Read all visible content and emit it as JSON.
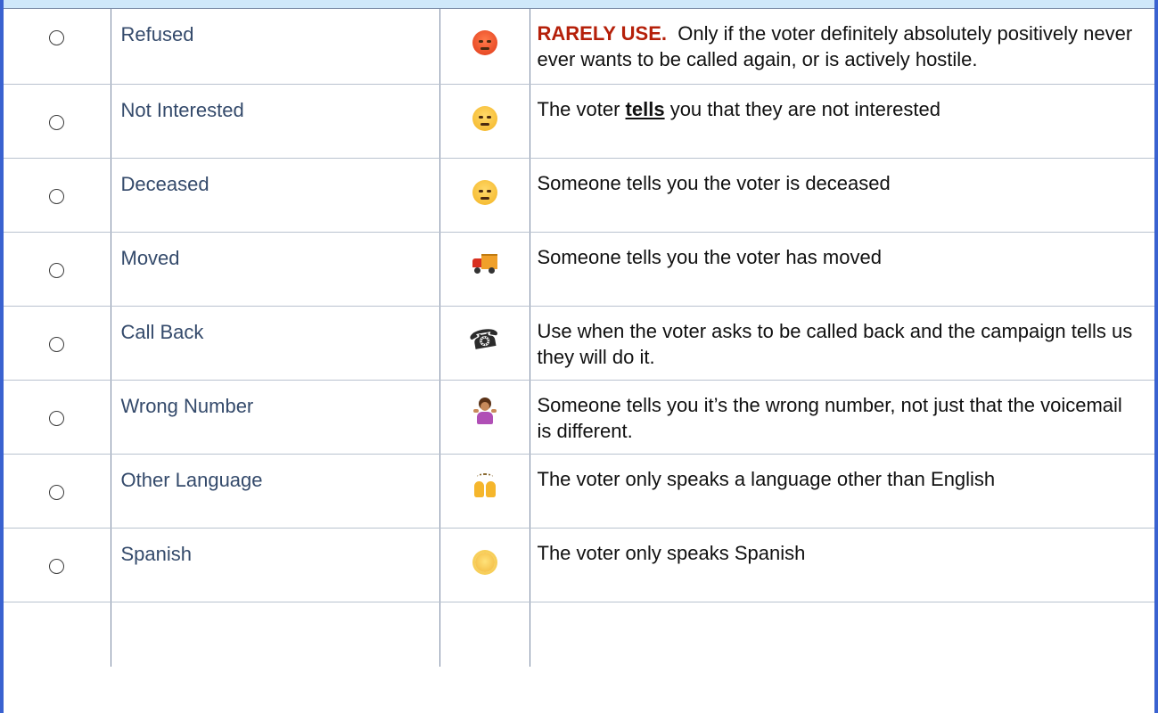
{
  "rows": [
    {
      "name": "Refused",
      "icon": "angry-face-icon",
      "desc_prefix": "RARELY USE.",
      "desc": "  Only if the voter definitely absolutely positively never ever wants to be called again, or is actively hostile."
    },
    {
      "name": "Not Interested",
      "icon": "unamused-face-icon",
      "desc_a": "The voter ",
      "desc_em": "tells",
      "desc_b": " you that they are not interested"
    },
    {
      "name": "Deceased",
      "icon": "pensive-face-icon",
      "desc": "Someone tells you the voter is deceased"
    },
    {
      "name": "Moved",
      "icon": "delivery-truck-icon",
      "desc": "Someone tells you the voter has moved"
    },
    {
      "name": "Call Back",
      "icon": "telephone-receiver-icon",
      "desc": "Use when the voter asks to be called back and the campaign tells us they will do it."
    },
    {
      "name": "Wrong Number",
      "icon": "shrugging-person-icon",
      "desc": "Someone tells you it’s the wrong number, not just that the voicemail is different."
    },
    {
      "name": "Other Language",
      "icon": "raising-hands-icon",
      "desc": "The voter only speaks a language other than English"
    },
    {
      "name": "Spanish",
      "icon": "sun-with-face-icon",
      "desc": "The voter only speaks Spanish"
    }
  ],
  "colors": {
    "frame_border": "#3a62d0",
    "name_text": "#344a6b",
    "warning_text": "#b5200a",
    "header_strip": "#cfe8fa"
  }
}
